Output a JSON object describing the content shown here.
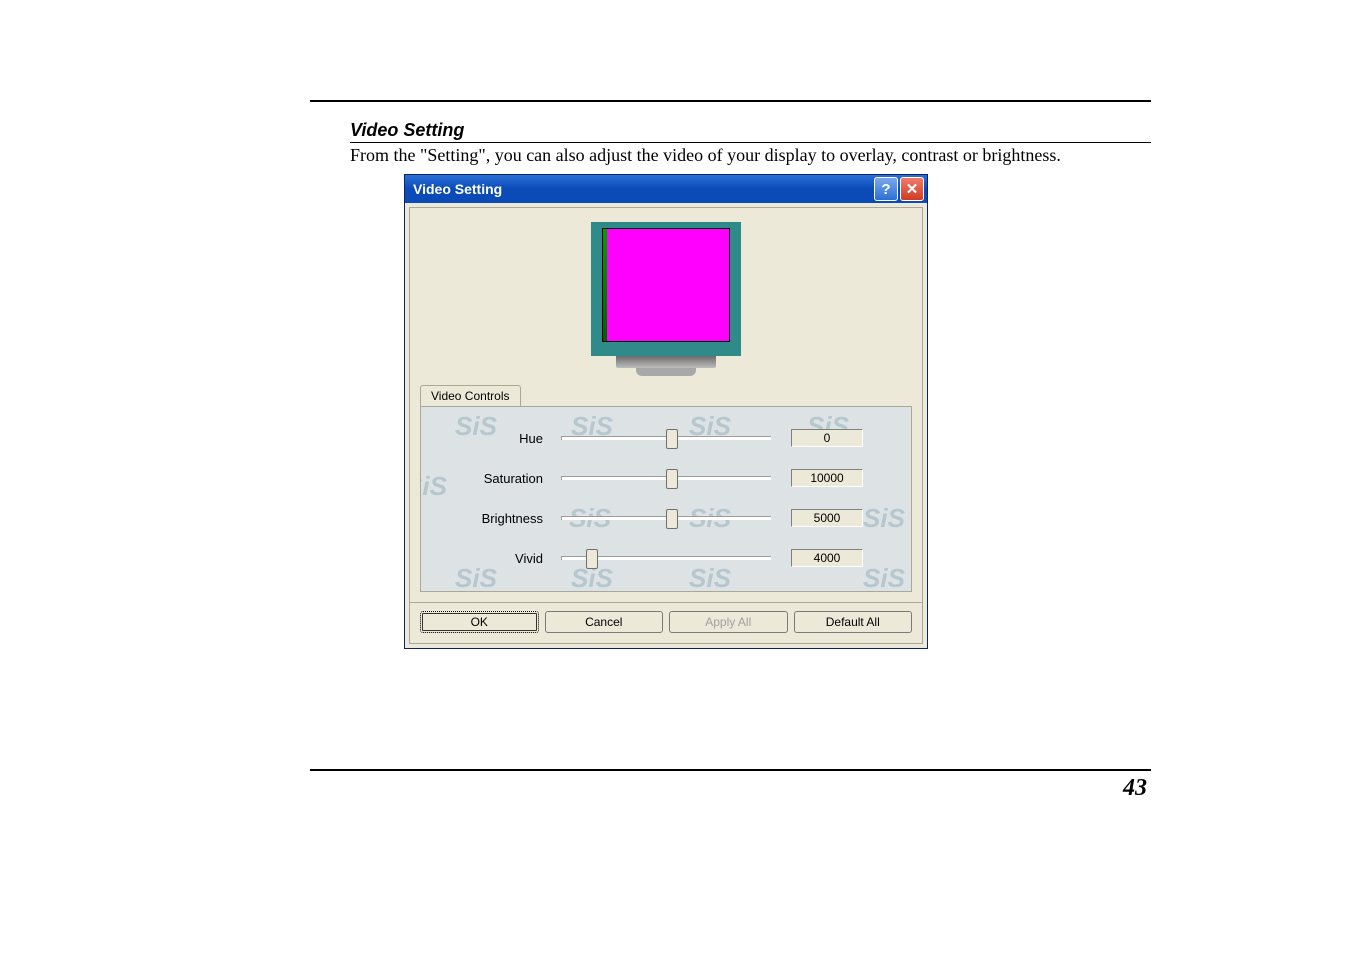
{
  "section": {
    "heading": "Video Setting",
    "body": "From the \"Setting\", you can also adjust the video of your display to overlay, contrast or brightness."
  },
  "dialog": {
    "title": "Video Setting",
    "tab_label": "Video Controls",
    "watermark": "SiS",
    "controls": [
      {
        "label": "Hue",
        "value": "0",
        "pos": 50
      },
      {
        "label": "Saturation",
        "value": "10000",
        "pos": 50
      },
      {
        "label": "Brightness",
        "value": "5000",
        "pos": 50
      },
      {
        "label": "Vivid",
        "value": "4000",
        "pos": 12
      }
    ],
    "buttons": {
      "ok": "OK",
      "cancel": "Cancel",
      "apply_all": "Apply All",
      "default_all": "Default All"
    }
  },
  "page_number": "43"
}
